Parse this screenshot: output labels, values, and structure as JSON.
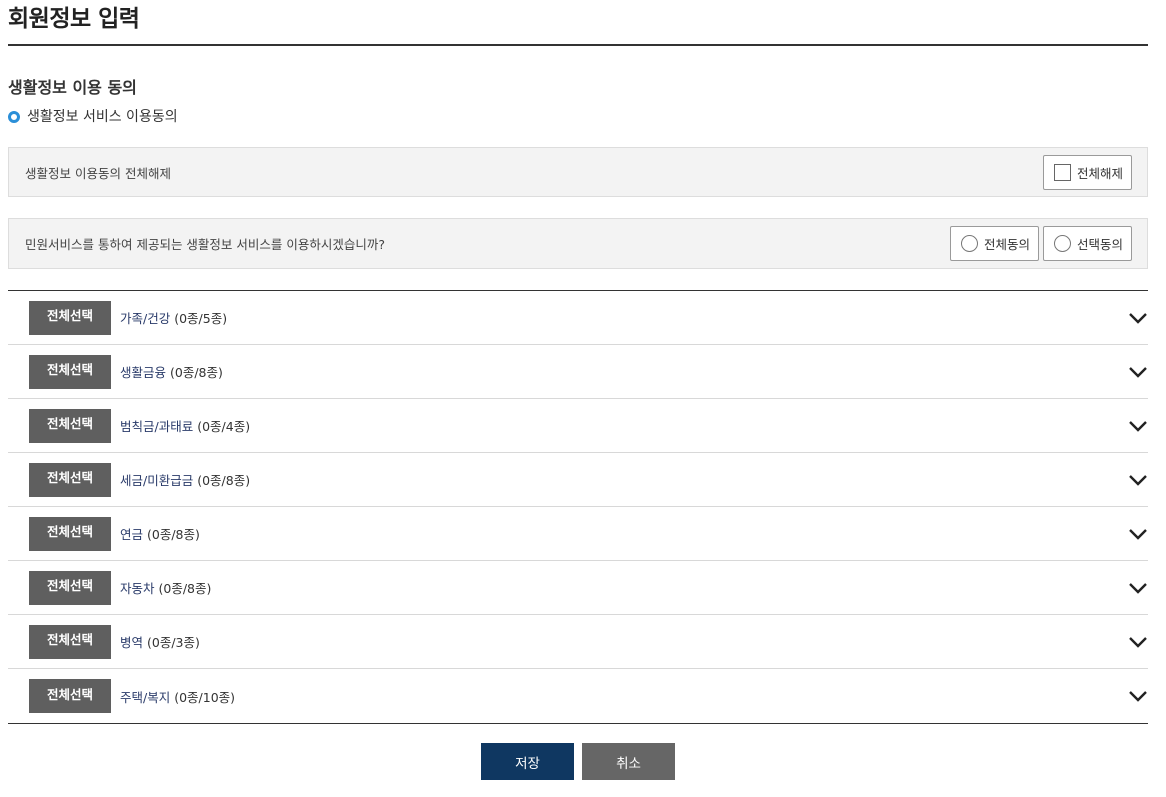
{
  "page": {
    "title": "회원정보 입력"
  },
  "section": {
    "title": "생활정보 이용 동의",
    "subtitle": "생활정보 서비스 이용동의"
  },
  "withdraw_box": {
    "text": "생활정보 이용동의 전체해제",
    "button_label": "전체해제"
  },
  "consent_box": {
    "question": "민원서비스를 통하여 제공되는 생활정보 서비스를 이용하시겠습니까?",
    "options": [
      "전체동의",
      "선택동의"
    ]
  },
  "categories": [
    {
      "button": "전체선택",
      "name": "가족/건강",
      "count": "(0종/5종)"
    },
    {
      "button": "전체선택",
      "name": "생활금융",
      "count": "(0종/8종)"
    },
    {
      "button": "전체선택",
      "name": "범칙금/과태료",
      "count": "(0종/4종)"
    },
    {
      "button": "전체선택",
      "name": "세금/미환급금",
      "count": "(0종/8종)"
    },
    {
      "button": "전체선택",
      "name": "연금",
      "count": "(0종/8종)"
    },
    {
      "button": "전체선택",
      "name": "자동차",
      "count": "(0종/8종)"
    },
    {
      "button": "전체선택",
      "name": "병역",
      "count": "(0종/3종)"
    },
    {
      "button": "전체선택",
      "name": "주택/복지",
      "count": "(0종/10종)"
    }
  ],
  "actions": {
    "save": "저장",
    "cancel": "취소"
  },
  "colors": {
    "accent_blue": "#2b8fd8",
    "save_button": "#0f3761",
    "cancel_button": "#666666",
    "select_button": "#5f5f5f",
    "category_text": "#2a3b6a"
  },
  "icons": {
    "bullet": "ring-bullet-icon",
    "checkbox": "checkbox-icon",
    "radio": "radio-icon",
    "expand": "chevron-down-icon"
  }
}
